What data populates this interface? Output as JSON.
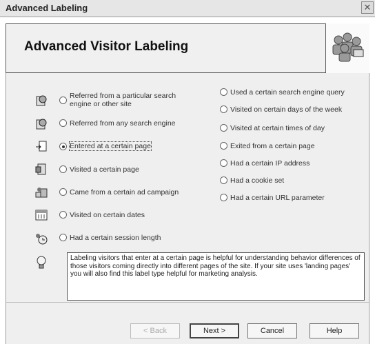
{
  "window": {
    "title": "Advanced Labeling"
  },
  "banner": {
    "heading": "Advanced Visitor Labeling"
  },
  "left_options": [
    {
      "label": "Referred from a particular search engine or other site",
      "icon": "globe-icon",
      "checked": false
    },
    {
      "label": "Referred from any search engine",
      "icon": "globe-icon",
      "checked": false
    },
    {
      "label": "Entered at a certain page",
      "icon": "page-enter-icon",
      "checked": true
    },
    {
      "label": "Visited a certain page",
      "icon": "page-visit-icon",
      "checked": false
    },
    {
      "label": "Came from a certain ad campaign",
      "icon": "campaign-icon",
      "checked": false
    },
    {
      "label": "Visited on certain dates",
      "icon": "calendar-icon",
      "checked": false
    },
    {
      "label": "Had a certain session length",
      "icon": "timer-icon",
      "checked": false
    }
  ],
  "right_options": [
    {
      "label": "Used a certain search engine query",
      "checked": false
    },
    {
      "label": "Visited on certain days of the week",
      "checked": false
    },
    {
      "label": "Visited at certain times of day",
      "checked": false
    },
    {
      "label": "Exited from a certain page",
      "checked": false
    },
    {
      "label": "Had a certain IP address",
      "checked": false
    },
    {
      "label": "Had a cookie set",
      "checked": false
    },
    {
      "label": "Had a certain URL parameter",
      "checked": false
    }
  ],
  "description": "Labeling visitors that enter at a certain page is helpful for understanding behavior differences of those visitors coming directly into different pages of the site. If your site uses 'landing pages' you will also find this label type helpful for marketing analysis.",
  "buttons": {
    "back": "< Back",
    "next": "Next >",
    "cancel": "Cancel",
    "help": "Help"
  }
}
